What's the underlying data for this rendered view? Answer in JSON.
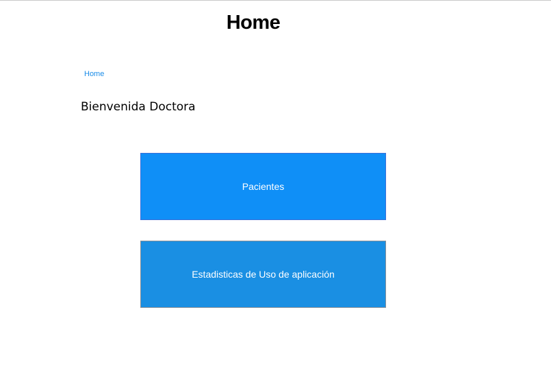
{
  "header": {
    "title": "Home"
  },
  "breadcrumb": {
    "home_label": "Home"
  },
  "main": {
    "welcome_text": "Bienvenida Doctora",
    "buttons": [
      {
        "label": "Pacientes"
      },
      {
        "label": "Estadisticas de Uso de aplicación"
      }
    ]
  },
  "colors": {
    "link": "#1a8ce8",
    "primary_button": "#0f8ff7",
    "secondary_button": "#1a8fe3"
  }
}
